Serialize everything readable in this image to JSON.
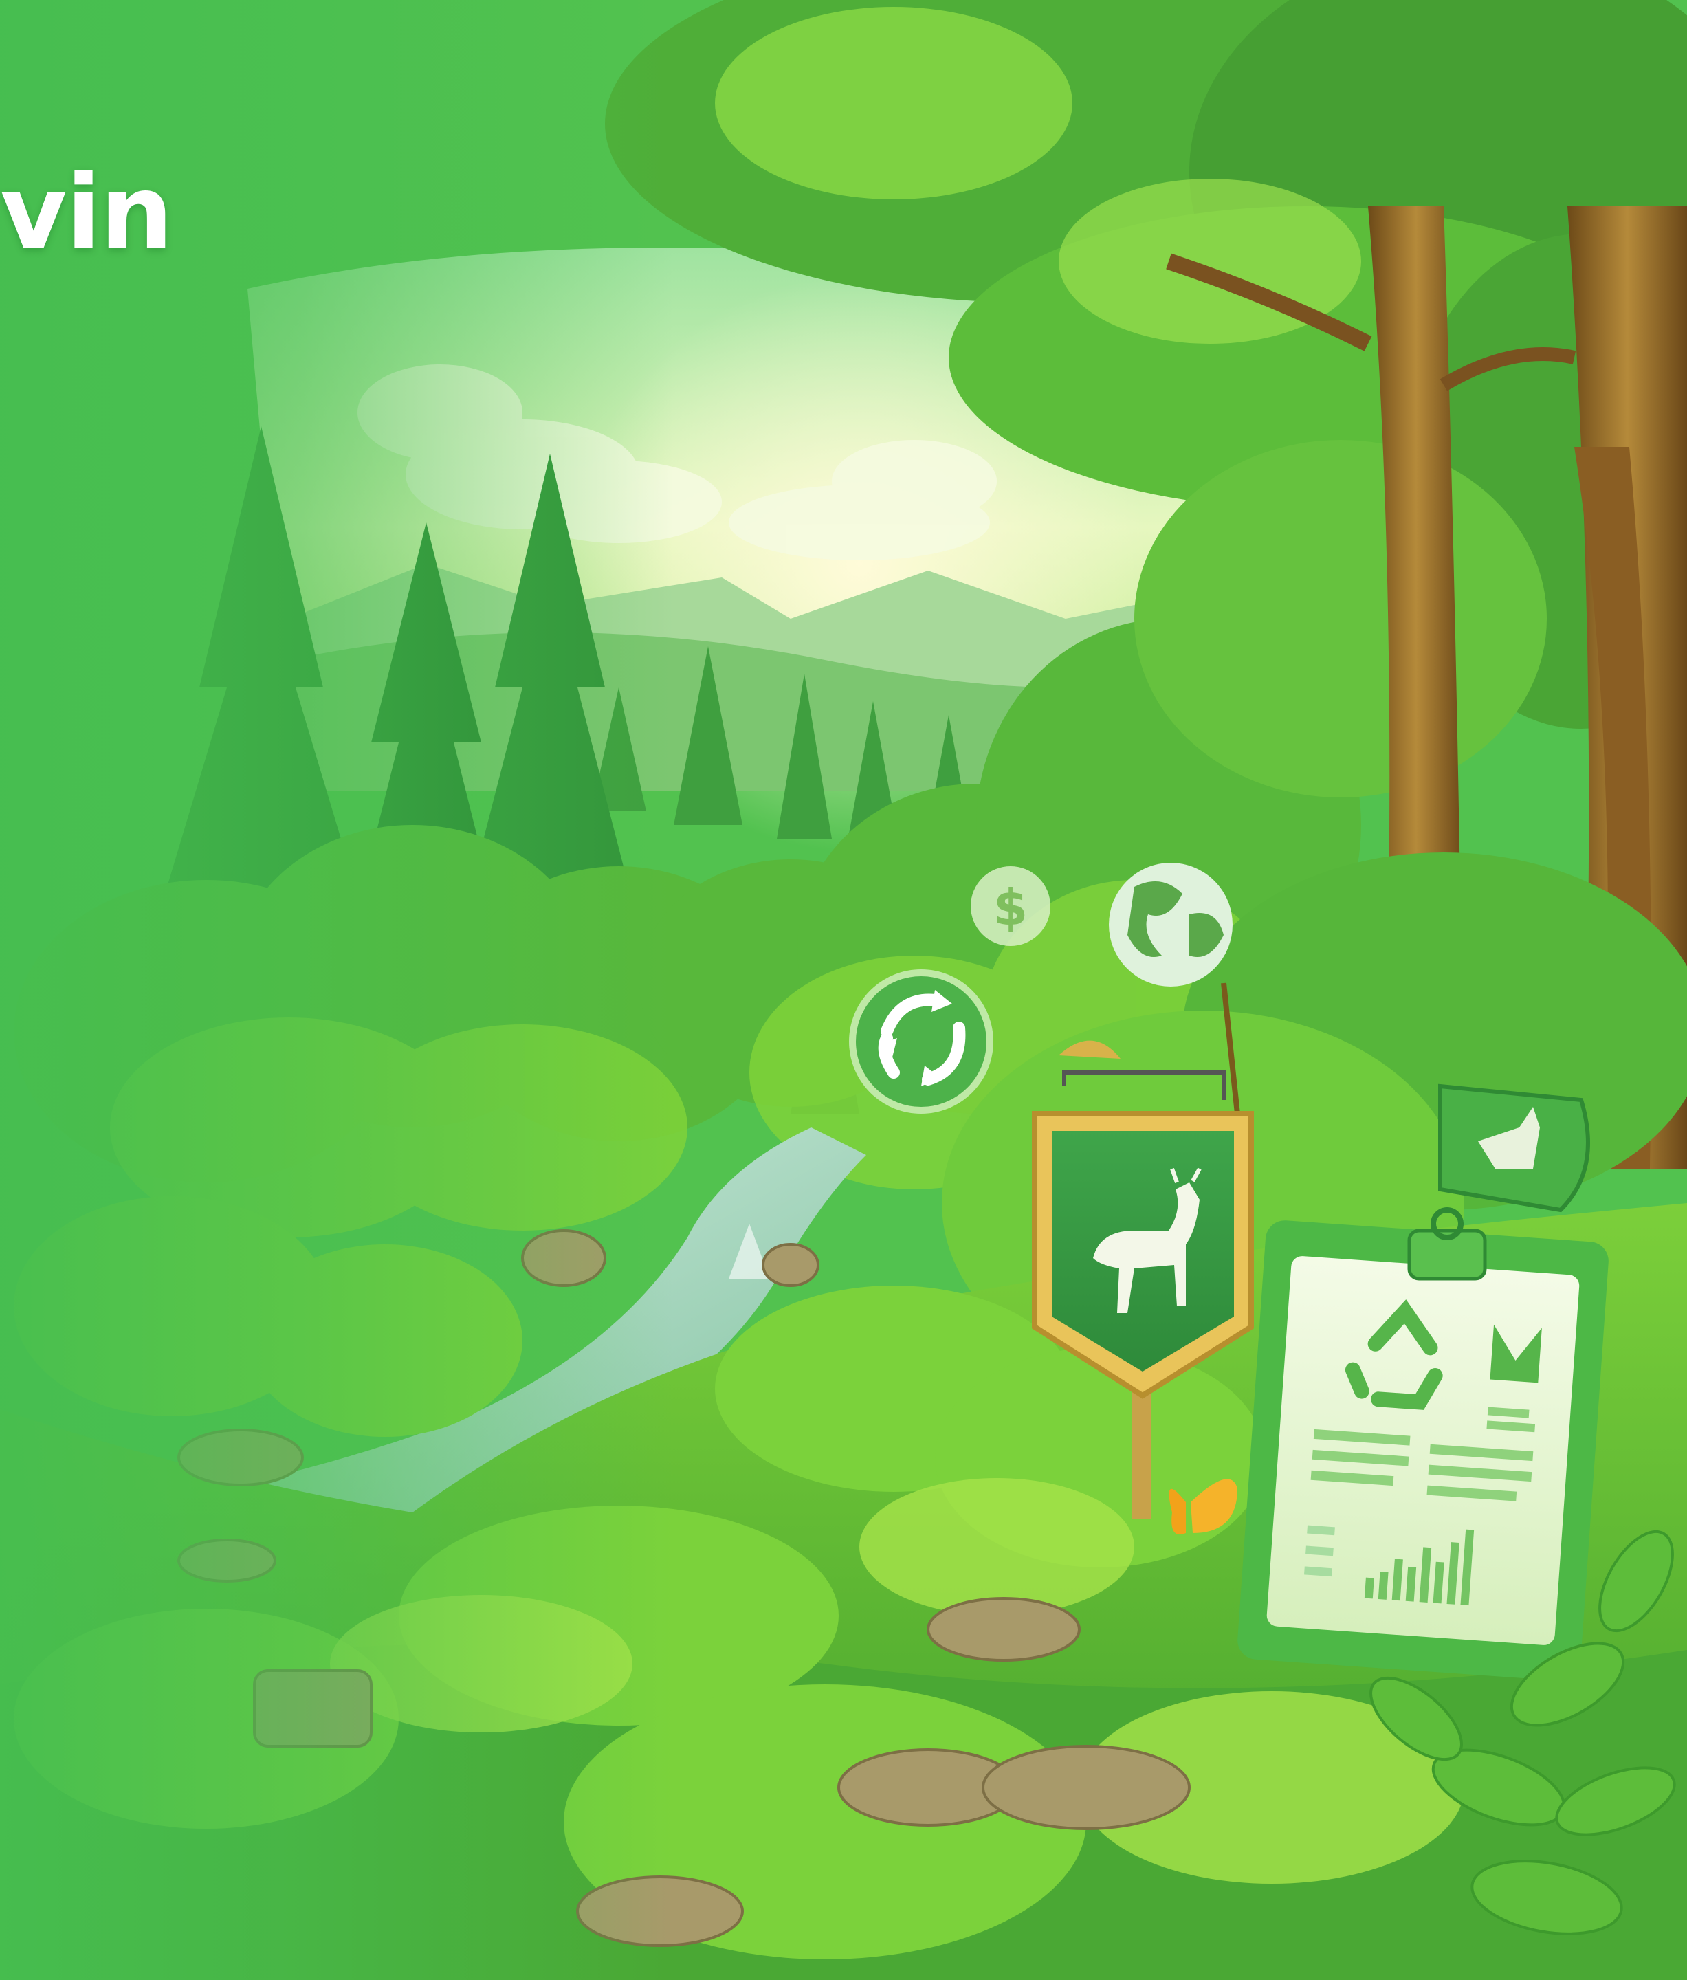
{
  "brand": {
    "text": "vin"
  },
  "icons": [
    "recycle-icon",
    "globe-icon",
    "dollar-icon",
    "deer-icon",
    "report-clipboard-icon",
    "butterfly-icon"
  ],
  "colors": {
    "sky": "#e9f7c2",
    "forest": "#2f9a3a",
    "foliage": "#7fd23a",
    "badge": "#4caf50",
    "wood": "#a7742e",
    "gold": "#d8b24a",
    "butterfly": "#f2a21a"
  }
}
